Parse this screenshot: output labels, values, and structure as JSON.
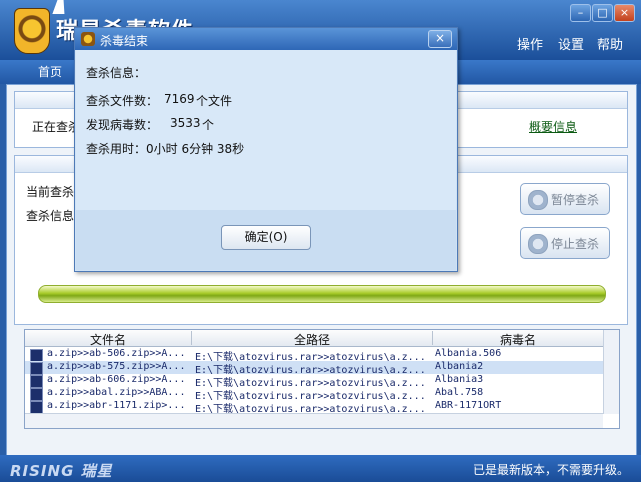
{
  "window": {
    "app_title": "瑞星杀毒软件",
    "menu": [
      "操作",
      "设置",
      "帮助"
    ],
    "controls": {
      "minimize": "–",
      "maximize": "□",
      "close": "×"
    },
    "nav": {
      "home": "首页"
    }
  },
  "scan_panel": {
    "status_label": "正在查杀",
    "summary_link": "概要信息"
  },
  "info_panel": {
    "current_label": "当前查杀",
    "info_label": "查杀信息",
    "pause_button": "暂停查杀",
    "stop_button": "停止查杀"
  },
  "progress": {
    "value": 1.0
  },
  "virus_table": {
    "columns": [
      "文件名",
      "全路径",
      "病毒名"
    ],
    "rows": [
      {
        "file": "a.zip>>ab-506.zip>>A...",
        "path": "E:\\下载\\atozvirus.rar>>atozvirus\\a.z...",
        "virus": "Albania.506",
        "selected": false
      },
      {
        "file": "a.zip>>ab-575.zip>>A...",
        "path": "E:\\下载\\atozvirus.rar>>atozvirus\\a.z...",
        "virus": "Albania2",
        "selected": true
      },
      {
        "file": "a.zip>>ab-606.zip>>A...",
        "path": "E:\\下载\\atozvirus.rar>>atozvirus\\a.z...",
        "virus": "Albania3",
        "selected": false
      },
      {
        "file": "a.zip>>abal.zip>>ABA...",
        "path": "E:\\下载\\atozvirus.rar>>atozvirus\\a.z...",
        "virus": "Abal.758",
        "selected": false
      },
      {
        "file": "a.zip>>abr-1171.zip>...",
        "path": "E:\\下载\\atozvirus.rar>>atozvirus\\a.z...",
        "virus": "ABR-1171ORT",
        "selected": false
      }
    ]
  },
  "statusbar": {
    "brand": "RISING 瑞星",
    "message": "已是最新版本，不需要升级。"
  },
  "dialog": {
    "title": "杀毒结束",
    "close": "×",
    "heading": "查杀信息：",
    "files_label": "查杀文件数：",
    "files_value": "7169",
    "files_unit": "个文件",
    "viruses_label": "发现病毒数：",
    "viruses_value": "3533",
    "viruses_unit": "个",
    "time_label": "查杀用时：",
    "time_value": "0小时 6分钟 38秒",
    "ok_button": "确定(O)"
  }
}
